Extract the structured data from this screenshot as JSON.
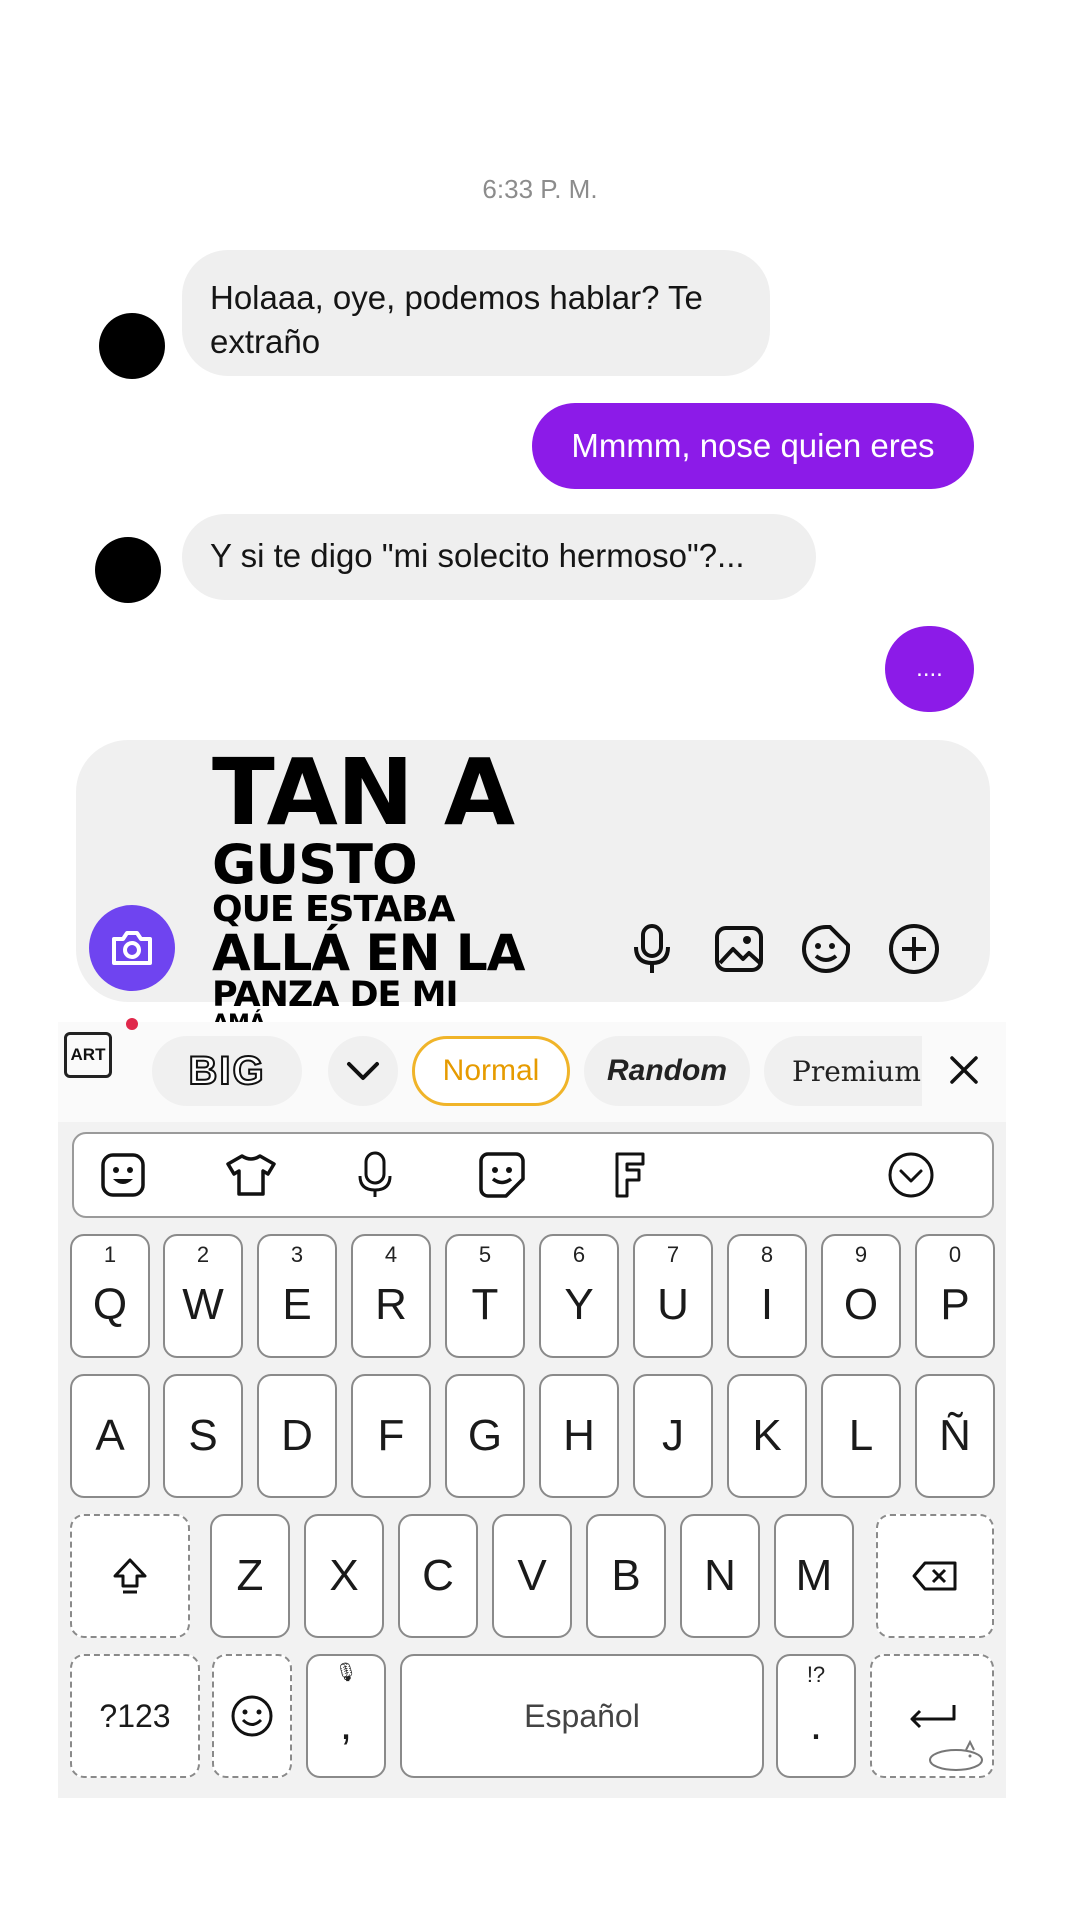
{
  "chat": {
    "timestamp": "6:33 P. M.",
    "messages": [
      {
        "from": "other",
        "text": "Holaaa, oye, podemos hablar? Te extraño"
      },
      {
        "from": "me",
        "text": "Mmmm, nose quien eres"
      },
      {
        "from": "other",
        "text": "Y si te digo \"mi solecito hermoso\"?..."
      },
      {
        "from": "me",
        "text": "...."
      }
    ],
    "accent_color": "#8c1be8",
    "incoming_color": "#efefef"
  },
  "overlay_caption": {
    "line1": "TAN A",
    "line2": "GUSTO",
    "line3": "QUE ESTABA",
    "line4": "ALLÁ EN LA",
    "line5": "PANZA DE MI",
    "line6": "AMÁ"
  },
  "composer": {
    "camera_color": "#6f44f0",
    "icons": [
      "camera-icon",
      "microphone-icon",
      "image-icon",
      "sticker-icon",
      "plus-icon"
    ]
  },
  "keyboard": {
    "strip": {
      "art_label": "ART",
      "big_label": "BIG",
      "fonts": [
        "Normal",
        "Random",
        "Premium"
      ],
      "selected_font": "Normal"
    },
    "toolbar_icons": [
      "emoji-face-icon",
      "tshirt-icon",
      "microphone-icon",
      "sticker-icon",
      "font-icon",
      "collapse-icon"
    ],
    "rows": [
      [
        {
          "k": "Q",
          "h": "1"
        },
        {
          "k": "W",
          "h": "2"
        },
        {
          "k": "E",
          "h": "3"
        },
        {
          "k": "R",
          "h": "4"
        },
        {
          "k": "T",
          "h": "5"
        },
        {
          "k": "Y",
          "h": "6"
        },
        {
          "k": "U",
          "h": "7"
        },
        {
          "k": "I",
          "h": "8"
        },
        {
          "k": "O",
          "h": "9"
        },
        {
          "k": "P",
          "h": "0"
        }
      ],
      [
        {
          "k": "A"
        },
        {
          "k": "S"
        },
        {
          "k": "D"
        },
        {
          "k": "F"
        },
        {
          "k": "G"
        },
        {
          "k": "H"
        },
        {
          "k": "J"
        },
        {
          "k": "K"
        },
        {
          "k": "L"
        },
        {
          "k": "Ñ"
        }
      ],
      [
        {
          "k": "Z"
        },
        {
          "k": "X"
        },
        {
          "k": "C"
        },
        {
          "k": "V"
        },
        {
          "k": "B"
        },
        {
          "k": "N"
        },
        {
          "k": "M"
        }
      ]
    ],
    "symbols_label": "?123",
    "comma": ",",
    "space_label": "Español",
    "period": ".",
    "period_hint": "!?"
  }
}
